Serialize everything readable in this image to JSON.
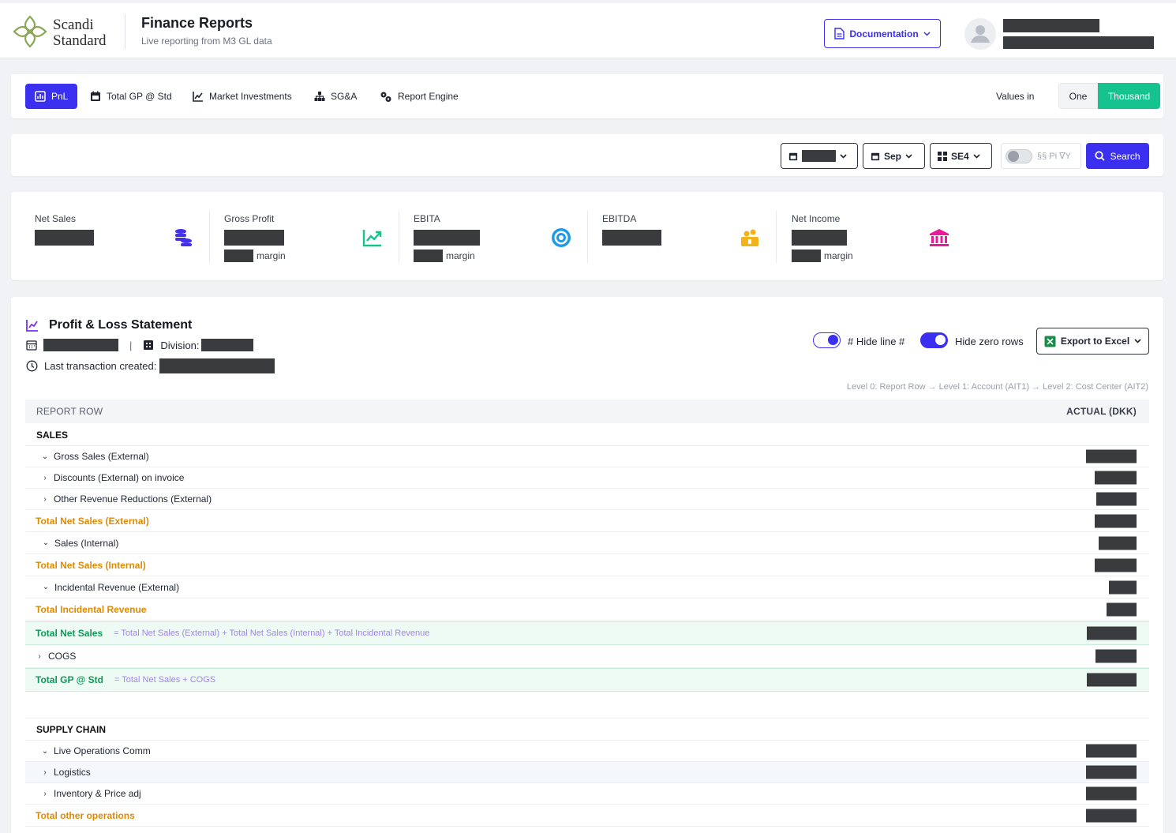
{
  "brand": {
    "name_line1": "Scandi",
    "name_line2": "Standard"
  },
  "header": {
    "title": "Finance Reports",
    "subtitle": "Live reporting from M3 GL data",
    "documentation_label": "Documentation"
  },
  "tabs": [
    {
      "label": "PnL",
      "icon": "chart-doc-icon",
      "active": true
    },
    {
      "label": "Total GP @ Std",
      "icon": "calendar-icon"
    },
    {
      "label": "Market Investments",
      "icon": "line-chart-icon"
    },
    {
      "label": "SG&A",
      "icon": "org-chart-icon"
    },
    {
      "label": "Report Engine",
      "icon": "gears-icon"
    }
  ],
  "values_in": {
    "label": "Values in",
    "one": "One",
    "thousand": "Thousand",
    "selected": "Thousand"
  },
  "filters": {
    "month": "Sep",
    "division": "SE4",
    "toggle_label": "§§ Pi ∇Y",
    "search_label": "Search"
  },
  "kpis": [
    {
      "label": "Net Sales",
      "icon": "coins-icon"
    },
    {
      "label": "Gross Profit",
      "margin": "margin",
      "icon": "trend-up-icon"
    },
    {
      "label": "EBITA",
      "margin": "margin",
      "icon": "target-icon"
    },
    {
      "label": "EBITDA",
      "icon": "money-bag-icon"
    },
    {
      "label": "Net Income",
      "margin": "margin",
      "icon": "bank-icon"
    }
  ],
  "statement": {
    "title": "Profit & Loss Statement",
    "separator": "|",
    "division_label": "Division:",
    "last_tx_label": "Last transaction created:",
    "hide_line_label": "# Hide line #",
    "hide_zero_label": "Hide zero rows",
    "export_label": "Export to Excel",
    "legend": "Level 0: Report Row → Level 1: Account (AIT1) → Level 2: Cost Center (AIT2)",
    "col_left": "REPORT ROW",
    "col_right": "ACTUAL (DKK)"
  },
  "rows": [
    {
      "label": "SALES",
      "type": "section"
    },
    {
      "label": "Gross Sales (External)",
      "chevron": "v"
    },
    {
      "label": "Discounts (External) on invoice",
      "chevron": ">"
    },
    {
      "label": "Other Revenue Reductions (External)",
      "chevron": ">"
    },
    {
      "label": "Total Net Sales (External)",
      "type": "total"
    },
    {
      "label": "Sales (Internal)",
      "chevron": "v"
    },
    {
      "label": "Total Net Sales (Internal)",
      "type": "total"
    },
    {
      "label": "Incidental Revenue (External)",
      "chevron": "v"
    },
    {
      "label": "Total Incidental Revenue",
      "type": "total"
    },
    {
      "label": "Total Net Sales",
      "type": "gtotal",
      "formula": "= Total Net Sales (External) + Total Net Sales (Internal) + Total Incidental Revenue"
    },
    {
      "label": "COGS",
      "chevron": ">"
    },
    {
      "label": "Total GP @ Std",
      "type": "gtotal",
      "formula": "= Total Net Sales + COGS"
    },
    {
      "label": "SUPPLY CHAIN",
      "type": "section"
    },
    {
      "label": "Live Operations Comm",
      "chevron": "v"
    },
    {
      "label": "Logistics",
      "chevron": ">"
    },
    {
      "label": "Inventory & Price adj",
      "chevron": ">"
    },
    {
      "label": "Total other operations",
      "type": "total"
    }
  ],
  "colors": {
    "primary": "#3b2ff0",
    "accent_green": "#14c38e",
    "total_orange": "#e08a00",
    "gtotal_green": "#0e9a57",
    "formula_purple": "#a286e8"
  }
}
